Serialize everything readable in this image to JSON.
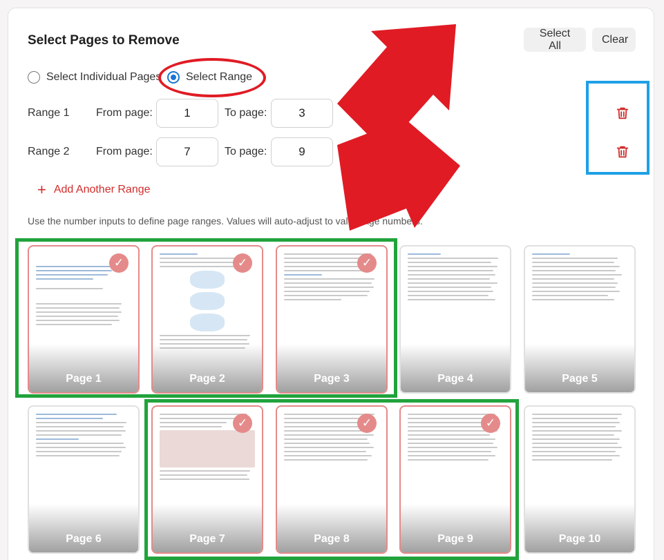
{
  "title": "Select Pages to Remove",
  "buttons": {
    "select_all": "Select All",
    "clear": "Clear"
  },
  "mode": {
    "individual_label": "Select Individual Pages",
    "range_label": "Select Range",
    "selected": "range"
  },
  "ranges": [
    {
      "label": "Range 1",
      "from_label": "From page:",
      "from": "1",
      "to_label": "To page:",
      "to": "3"
    },
    {
      "label": "Range 2",
      "from_label": "From page:",
      "from": "7",
      "to_label": "To page:",
      "to": "9"
    }
  ],
  "add_range": "Add Another Range",
  "hint": "Use the number inputs to define page ranges. Values will auto-adjust to valid page numbers.",
  "pages": [
    {
      "label": "Page 1",
      "selected": true
    },
    {
      "label": "Page 2",
      "selected": true
    },
    {
      "label": "Page 3",
      "selected": true
    },
    {
      "label": "Page 4",
      "selected": false
    },
    {
      "label": "Page 5",
      "selected": false
    },
    {
      "label": "Page 6",
      "selected": false
    },
    {
      "label": "Page 7",
      "selected": true
    },
    {
      "label": "Page 8",
      "selected": true
    },
    {
      "label": "Page 9",
      "selected": true
    },
    {
      "label": "Page 10",
      "selected": false
    }
  ],
  "colors": {
    "accent_red": "#d22c2c",
    "radio_blue": "#1976d2",
    "annotation_red": "#e01b24",
    "annotation_blue": "#1ea0e6",
    "annotation_green": "#21a33c",
    "selected_page": "#e58a8a"
  },
  "icons": {
    "trash": "trash-icon",
    "check": "check-icon",
    "plus": "plus-icon"
  }
}
